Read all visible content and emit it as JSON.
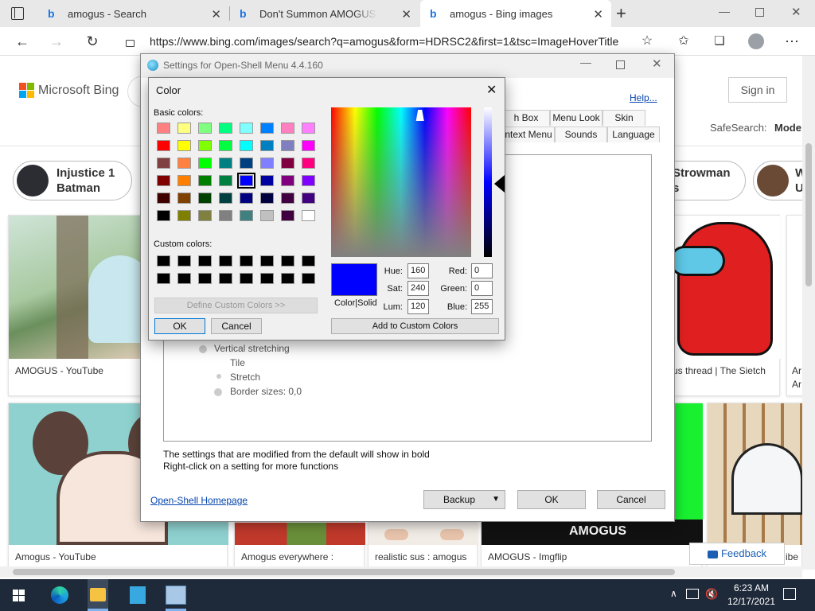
{
  "browser": {
    "tabs": [
      {
        "title": "amogus - Search",
        "favicon": "bing-icon"
      },
      {
        "title": "Don't Summon AMOGUS in",
        "favicon": "bing-icon"
      },
      {
        "title": "amogus - Bing images",
        "favicon": "bing-icon"
      }
    ],
    "url": "https://www.bing.com/images/search?q=amogus&form=HDRSC2&first=1&tsc=ImageHoverTitle"
  },
  "bing": {
    "logo_text": "Microsoft Bing",
    "sign_in": "Sign in",
    "safesearch_label": "SafeSearch:",
    "safesearch_value": "Mode",
    "pills": [
      {
        "line1": "Injustice 1",
        "line2": "Batman"
      },
      {
        "line1": "Strowman",
        "line2": "s"
      },
      {
        "line1": "W",
        "line2": "U"
      }
    ],
    "captions": {
      "r1c1": "AMOGUS - YouTube",
      "r1c4": "us thread | The Sietch",
      "r1c5a": "Ar",
      "r1c5b": "Ar",
      "r2c1": "Amogus - YouTube",
      "r2c2": "Amogus everywhere :",
      "r2c3": "realistic sus : amogus",
      "r2c4": "AMOGUS - Imgflip",
      "r2c5": "ibe",
      "amogus_banner": "AMOGUS"
    },
    "feedback": "Feedback"
  },
  "settings": {
    "title": "Settings for Open-Shell Menu 4.4.160",
    "help": "Help...",
    "tabs_row1": [
      "h Box",
      "Menu Look",
      "Skin"
    ],
    "tabs_row2": [
      "ntext Menu",
      "Sounds",
      "Language"
    ],
    "tree": [
      "Vertical stretching",
      "Tile",
      "Stretch",
      "Border sizes: 0,0"
    ],
    "note1": "The settings that are modified from the default will show in bold",
    "note2": "Right-click on a setting for more functions",
    "homepage": "Open-Shell Homepage",
    "backup": "Backup",
    "ok": "OK",
    "cancel": "Cancel"
  },
  "color_dialog": {
    "title": "Color",
    "basic_label": "Basic colors:",
    "custom_label": "Custom colors:",
    "define_btn": "Define Custom Colors >>",
    "ok": "OK",
    "cancel": "Cancel",
    "add_btn": "Add to Custom Colors",
    "color_solid": "Color|Solid",
    "hue_label": "Hue:",
    "hue": "160",
    "sat_label": "Sat:",
    "sat": "240",
    "lum_label": "Lum:",
    "lum": "120",
    "red_label": "Red:",
    "red": "0",
    "green_label": "Green:",
    "green": "0",
    "blue_label": "Blue:",
    "blue": "255",
    "current_color": "#0000ff",
    "basic_colors": [
      [
        "#ff8080",
        "#ffff80",
        "#80ff80",
        "#00ff80",
        "#80ffff",
        "#0080ff",
        "#ff80c0",
        "#ff80ff"
      ],
      [
        "#ff0000",
        "#ffff00",
        "#80ff00",
        "#00ff40",
        "#00ffff",
        "#0080c0",
        "#8080c0",
        "#ff00ff"
      ],
      [
        "#804040",
        "#ff8040",
        "#00ff00",
        "#008080",
        "#004080",
        "#8080ff",
        "#800040",
        "#ff0080"
      ],
      [
        "#800000",
        "#ff8000",
        "#008000",
        "#008040",
        "#0000ff",
        "#0000a0",
        "#800080",
        "#8000ff"
      ],
      [
        "#400000",
        "#804000",
        "#004000",
        "#004040",
        "#000080",
        "#000040",
        "#400040",
        "#400080"
      ],
      [
        "#000000",
        "#808000",
        "#808040",
        "#808080",
        "#408080",
        "#c0c0c0",
        "#400040",
        "#ffffff"
      ]
    ],
    "selected_index": [
      3,
      4
    ]
  },
  "taskbar": {
    "time": "6:23 AM",
    "date": "12/17/2021"
  }
}
